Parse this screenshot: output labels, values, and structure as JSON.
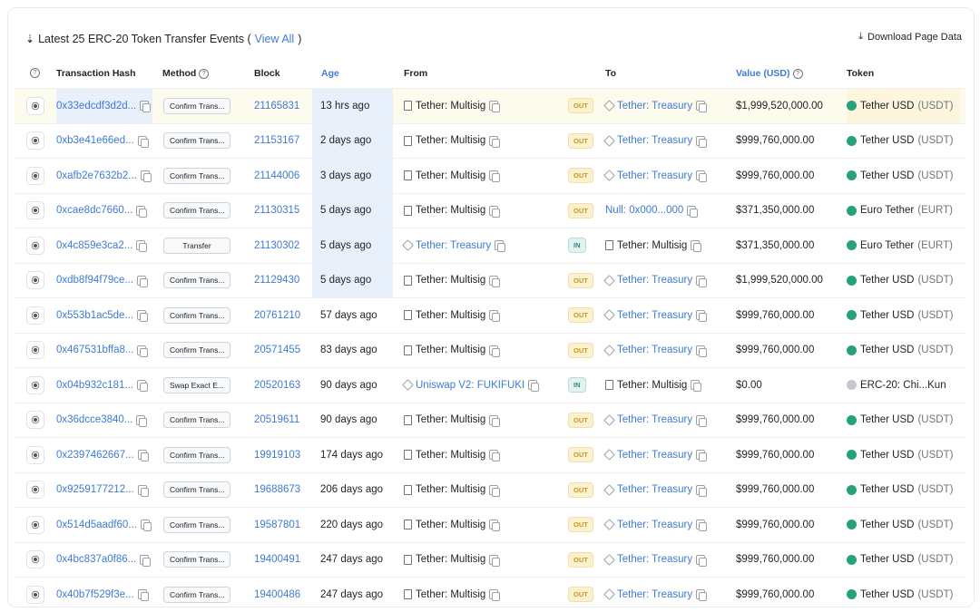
{
  "header": {
    "sort_icon": "sort-down-icon",
    "title": "Latest 25 ERC-20 Token Transfer Events (",
    "view_all": "View All",
    "close_paren": ")",
    "download": "Download Page Data",
    "download_icon": "download-icon"
  },
  "columns": {
    "hash": "Transaction Hash",
    "method": "Method",
    "block": "Block",
    "age": "Age",
    "from": "From",
    "to": "To",
    "value": "Value (USD)",
    "token": "Token"
  },
  "colors": {
    "link": "#3d7bd6",
    "out": "#c79a1e",
    "in": "#2d8c7a",
    "tether": "#26a17b"
  },
  "rows": [
    {
      "hash": "0x33edcdf3d2d...",
      "method": "Confirm Trans...",
      "block": "21165831",
      "age": "13 hrs ago",
      "from": "Tether: Multisig",
      "dir": "OUT",
      "to": "Tether: Treasury",
      "value": "$1,999,520,000.00",
      "token": "Tether USD",
      "sym": "(USDT)"
    },
    {
      "hash": "0xb3e41e66ed...",
      "method": "Confirm Trans...",
      "block": "21153167",
      "age": "2 days ago",
      "from": "Tether: Multisig",
      "dir": "OUT",
      "to": "Tether: Treasury",
      "value": "$999,760,000.00",
      "token": "Tether USD",
      "sym": "(USDT)"
    },
    {
      "hash": "0xafb2e7632b2...",
      "method": "Confirm Trans...",
      "block": "21144006",
      "age": "3 days ago",
      "from": "Tether: Multisig",
      "dir": "OUT",
      "to": "Tether: Treasury",
      "value": "$999,760,000.00",
      "token": "Tether USD",
      "sym": "(USDT)"
    },
    {
      "hash": "0xcae8dc7660...",
      "method": "Confirm Trans...",
      "block": "21130315",
      "age": "5 days ago",
      "from": "Tether: Multisig",
      "dir": "OUT",
      "to": "Null: 0x000...000",
      "value": "$371,350,000.00",
      "token": "Euro Tether",
      "sym": "(EURT)"
    },
    {
      "hash": "0x4c859e3ca2...",
      "method": "Transfer",
      "block": "21130302",
      "age": "5 days ago",
      "from": "Tether: Treasury",
      "dir": "IN",
      "to": "Tether: Multisig",
      "value": "$371,350,000.00",
      "token": "Euro Tether",
      "sym": "(EURT)"
    },
    {
      "hash": "0xdb8f94f79ce...",
      "method": "Confirm Trans...",
      "block": "21129430",
      "age": "5 days ago",
      "from": "Tether: Multisig",
      "dir": "OUT",
      "to": "Tether: Treasury",
      "value": "$1,999,520,000.00",
      "token": "Tether USD",
      "sym": "(USDT)"
    },
    {
      "hash": "0x553b1ac5de...",
      "method": "Confirm Trans...",
      "block": "20761210",
      "age": "57 days ago",
      "from": "Tether: Multisig",
      "dir": "OUT",
      "to": "Tether: Treasury",
      "value": "$999,760,000.00",
      "token": "Tether USD",
      "sym": "(USDT)"
    },
    {
      "hash": "0x467531bffa8...",
      "method": "Confirm Trans...",
      "block": "20571455",
      "age": "83 days ago",
      "from": "Tether: Multisig",
      "dir": "OUT",
      "to": "Tether: Treasury",
      "value": "$999,760,000.00",
      "token": "Tether USD",
      "sym": "(USDT)"
    },
    {
      "hash": "0x04b932c181...",
      "method": "Swap Exact E...",
      "block": "20520163",
      "age": "90 days ago",
      "from": "Uniswap V2: FUKIFUKI",
      "dir": "IN",
      "to": "Tether: Multisig",
      "value": "$0.00",
      "token": "ERC-20: Chi...Kun",
      "sym": ""
    },
    {
      "hash": "0x36dcce3840...",
      "method": "Confirm Trans...",
      "block": "20519611",
      "age": "90 days ago",
      "from": "Tether: Multisig",
      "dir": "OUT",
      "to": "Tether: Treasury",
      "value": "$999,760,000.00",
      "token": "Tether USD",
      "sym": "(USDT)"
    },
    {
      "hash": "0x2397462667...",
      "method": "Confirm Trans...",
      "block": "19919103",
      "age": "174 days ago",
      "from": "Tether: Multisig",
      "dir": "OUT",
      "to": "Tether: Treasury",
      "value": "$999,760,000.00",
      "token": "Tether USD",
      "sym": "(USDT)"
    },
    {
      "hash": "0x9259177212...",
      "method": "Confirm Trans...",
      "block": "19688673",
      "age": "206 days ago",
      "from": "Tether: Multisig",
      "dir": "OUT",
      "to": "Tether: Treasury",
      "value": "$999,760,000.00",
      "token": "Tether USD",
      "sym": "(USDT)"
    },
    {
      "hash": "0x514d5aadf60...",
      "method": "Confirm Trans...",
      "block": "19587801",
      "age": "220 days ago",
      "from": "Tether: Multisig",
      "dir": "OUT",
      "to": "Tether: Treasury",
      "value": "$999,760,000.00",
      "token": "Tether USD",
      "sym": "(USDT)"
    },
    {
      "hash": "0x4bc837a0f86...",
      "method": "Confirm Trans...",
      "block": "19400491",
      "age": "247 days ago",
      "from": "Tether: Multisig",
      "dir": "OUT",
      "to": "Tether: Treasury",
      "value": "$999,760,000.00",
      "token": "Tether USD",
      "sym": "(USDT)"
    },
    {
      "hash": "0x40b7f529f3e...",
      "method": "Confirm Trans...",
      "block": "19400486",
      "age": "247 days ago",
      "from": "Tether: Multisig",
      "dir": "OUT",
      "to": "Tether: Treasury",
      "value": "$999,760,000.00",
      "token": "Tether USD",
      "sym": "(USDT)"
    }
  ]
}
